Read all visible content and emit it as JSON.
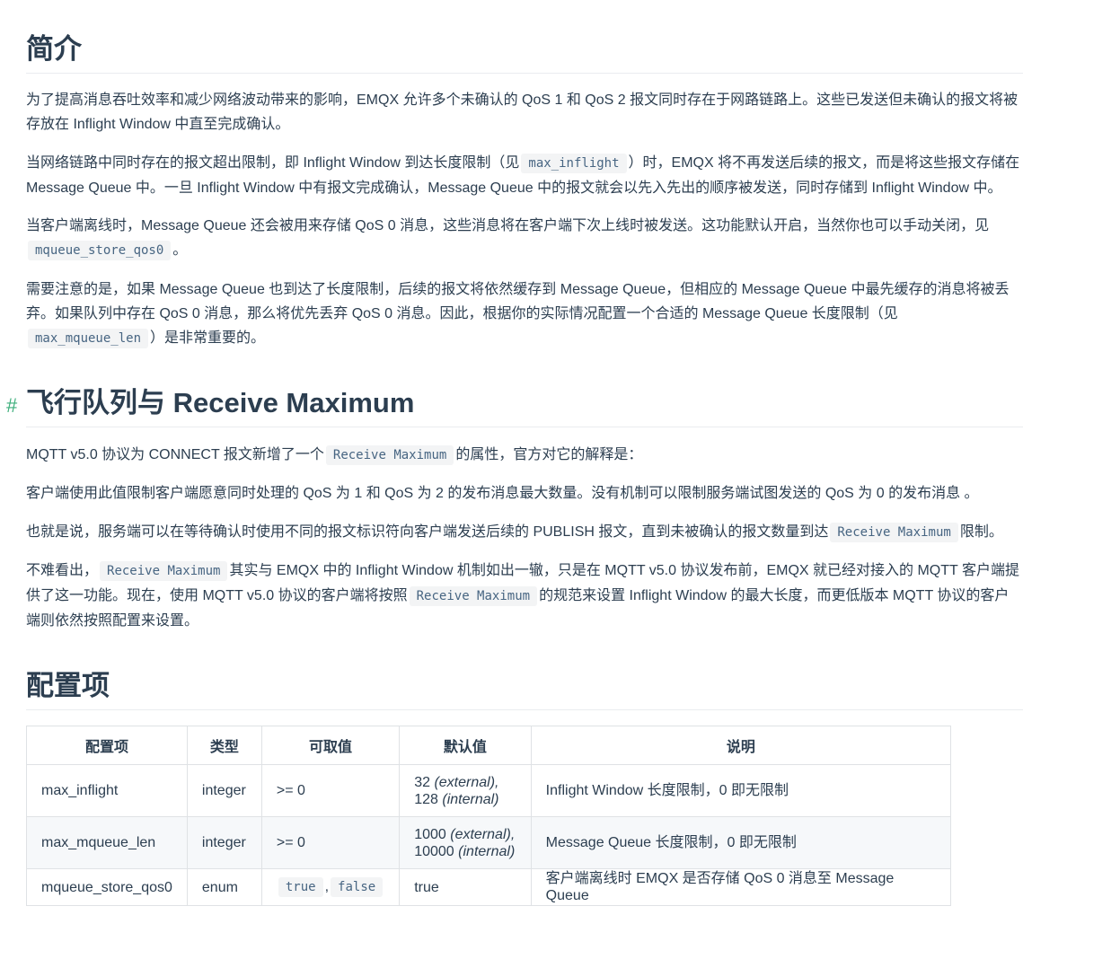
{
  "intro": {
    "heading": "简介",
    "p1": "为了提高消息吞吐效率和减少网络波动带来的影响，EMQX 允许多个未确认的 QoS 1 和 QoS 2 报文同时存在于网路链路上。这些已发送但未确认的报文将被存放在 Inflight Window 中直至完成确认。",
    "p2_a": "当网络链路中同时存在的报文超出限制，即 Inflight Window 到达长度限制（见",
    "p2_code": "max_inflight",
    "p2_b": "）时，EMQX 将不再发送后续的报文，而是将这些报文存储在 Message Queue 中。一旦 Inflight Window 中有报文完成确认，Message Queue 中的报文就会以先入先出的顺序被发送，同时存储到 Inflight Window 中。",
    "p3_a": "当客户端离线时，Message Queue 还会被用来存储 QoS 0 消息，这些消息将在客户端下次上线时被发送。这功能默认开启，当然你也可以手动关闭，见",
    "p3_code": "mqueue_store_qos0",
    "p3_b": "。",
    "p4_a": "需要注意的是，如果 Message Queue 也到达了长度限制，后续的报文将依然缓存到 Message Queue，但相应的 Message Queue 中最先缓存的消息将被丢弃。如果队列中存在 QoS 0 消息，那么将优先丢弃 QoS 0 消息。因此，根据你的实际情况配置一个合适的 Message Queue 长度限制（见",
    "p4_code": "max_mqueue_len",
    "p4_b": "）是非常重要的。"
  },
  "receive": {
    "anchor": "#",
    "heading": "飞行队列与 Receive Maximum",
    "p1_a": "MQTT v5.0 协议为 CONNECT 报文新增了一个",
    "p1_code": "Receive Maximum",
    "p1_b": "的属性，官方对它的解释是：",
    "p2": "客户端使用此值限制客户端愿意同时处理的 QoS 为 1 和 QoS 为 2 的发布消息最大数量。没有机制可以限制服务端试图发送的 QoS 为 0 的发布消息 。",
    "p3_a": "也就是说，服务端可以在等待确认时使用不同的报文标识符向客户端发送后续的 PUBLISH 报文，直到未被确认的报文数量到达",
    "p3_code": "Receive Maximum",
    "p3_b": "限制。",
    "p4_a": "不难看出，",
    "p4_code1": "Receive Maximum",
    "p4_b": "其实与 EMQX 中的 Inflight Window 机制如出一辙，只是在 MQTT v5.0 协议发布前，EMQX 就已经对接入的 MQTT 客户端提供了这一功能。现在，使用 MQTT v5.0 协议的客户端将按照",
    "p4_code2": "Receive Maximum",
    "p4_c": "的规范来设置 Inflight Window 的最大长度，而更低版本 MQTT 协议的客户端则依然按照配置来设置。"
  },
  "config": {
    "heading": "配置项",
    "headers": [
      "配置项",
      "类型",
      "可取值",
      "默认值",
      "说明"
    ],
    "rows": [
      {
        "name": "max_inflight",
        "type": "integer",
        "range": ">= 0",
        "default_v1": "32",
        "default_n1": "(external),",
        "default_v2": "128",
        "default_n2": "(internal)",
        "desc": "Inflight Window 长度限制，0 即无限制"
      },
      {
        "name": "max_mqueue_len",
        "type": "integer",
        "range": ">= 0",
        "default_v1": "1000",
        "default_n1": "(external),",
        "default_v2": "10000",
        "default_n2": "(internal)",
        "desc": "Message Queue 长度限制，0 即无限制"
      },
      {
        "name": "mqueue_store_qos0",
        "type": "enum",
        "range_code1": "true",
        "range_sep": ",",
        "range_code2": "false",
        "default": "true",
        "desc": "客户端离线时 EMQX 是否存储 QoS 0 消息至 Message Queue"
      }
    ]
  }
}
